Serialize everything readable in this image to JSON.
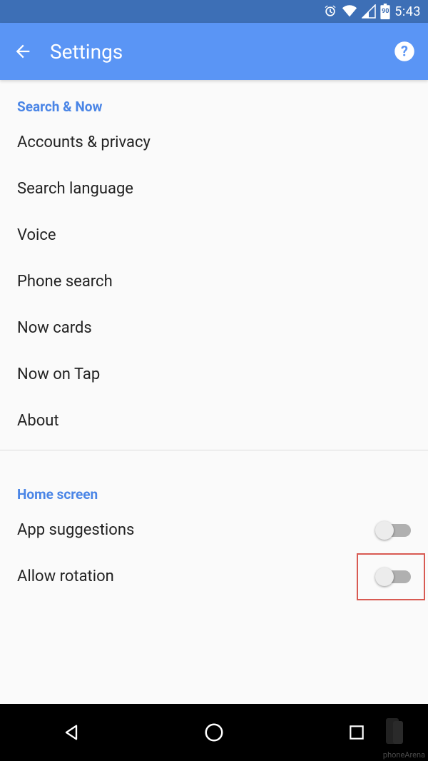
{
  "status": {
    "battery": "90",
    "time": "5:43"
  },
  "appbar": {
    "title": "Settings"
  },
  "sections": {
    "search_now": {
      "header": "Search & Now",
      "accounts": "Accounts & privacy",
      "language": "Search language",
      "voice": "Voice",
      "phone_search": "Phone search",
      "now_cards": "Now cards",
      "now_on_tap": "Now on Tap",
      "about": "About"
    },
    "home": {
      "header": "Home screen",
      "app_suggestions": "App suggestions",
      "allow_rotation": "Allow rotation"
    }
  },
  "watermark": "phoneArena"
}
